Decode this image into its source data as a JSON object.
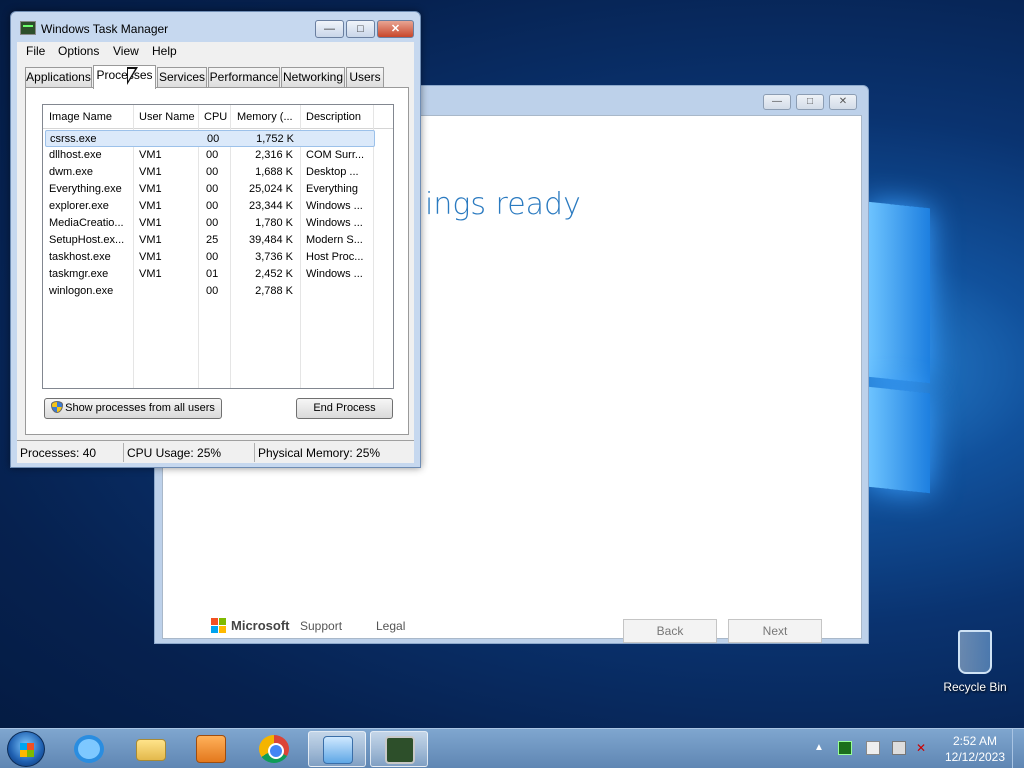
{
  "setup_window": {
    "heading": "ings ready",
    "footer": {
      "brand": "Microsoft",
      "support": "Support",
      "legal": "Legal"
    },
    "buttons": {
      "back": "Back",
      "next": "Next"
    }
  },
  "task_manager": {
    "title": "Windows Task Manager",
    "menu": [
      "File",
      "Options",
      "View",
      "Help"
    ],
    "tabs": [
      "Applications",
      "Processes",
      "Services",
      "Performance",
      "Networking",
      "Users"
    ],
    "active_tab": "Processes",
    "columns": [
      "Image Name",
      "User Name",
      "CPU",
      "Memory (...",
      "Description"
    ],
    "processes": [
      {
        "image": "csrss.exe",
        "user": "",
        "cpu": "00",
        "memory": "1,752 K",
        "desc": ""
      },
      {
        "image": "dllhost.exe",
        "user": "VM1",
        "cpu": "00",
        "memory": "2,316 K",
        "desc": "COM Surr..."
      },
      {
        "image": "dwm.exe",
        "user": "VM1",
        "cpu": "00",
        "memory": "1,688 K",
        "desc": "Desktop ..."
      },
      {
        "image": "Everything.exe",
        "user": "VM1",
        "cpu": "00",
        "memory": "25,024 K",
        "desc": "Everything"
      },
      {
        "image": "explorer.exe",
        "user": "VM1",
        "cpu": "00",
        "memory": "23,344 K",
        "desc": "Windows ..."
      },
      {
        "image": "MediaCreatio...",
        "user": "VM1",
        "cpu": "00",
        "memory": "1,780 K",
        "desc": "Windows ..."
      },
      {
        "image": "SetupHost.ex...",
        "user": "VM1",
        "cpu": "25",
        "memory": "39,484 K",
        "desc": "Modern S..."
      },
      {
        "image": "taskhost.exe",
        "user": "VM1",
        "cpu": "00",
        "memory": "3,736 K",
        "desc": "Host Proc..."
      },
      {
        "image": "taskmgr.exe",
        "user": "VM1",
        "cpu": "01",
        "memory": "2,452 K",
        "desc": "Windows ..."
      },
      {
        "image": "winlogon.exe",
        "user": "",
        "cpu": "00",
        "memory": "2,788 K",
        "desc": ""
      }
    ],
    "show_all_button": "Show processes from all users",
    "end_process_button": "End Process",
    "status": {
      "processes": "Processes: 40",
      "cpu": "CPU Usage: 25%",
      "memory": "Physical Memory: 25%"
    }
  },
  "desktop": {
    "recycle_bin": "Recycle Bin"
  },
  "taskbar": {
    "pinned": [
      "internet-explorer-icon",
      "explorer-folder-icon",
      "media-player-icon",
      "chrome-icon",
      "setup-icon",
      "task-manager-icon"
    ],
    "clock_time": "2:52 AM",
    "clock_date": "12/12/2023"
  }
}
